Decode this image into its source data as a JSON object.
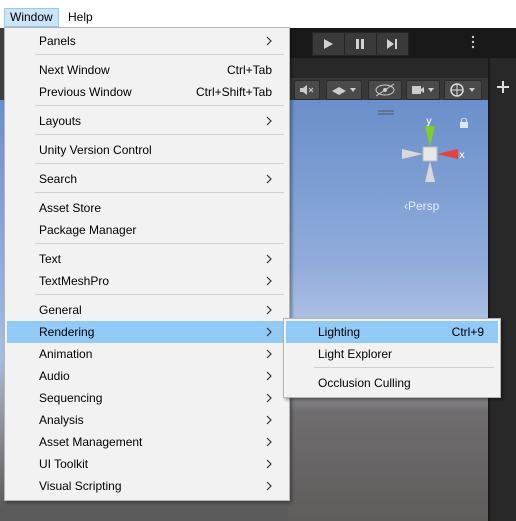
{
  "menubar": {
    "items": [
      {
        "label": "Window",
        "active": true
      },
      {
        "label": "Help",
        "active": false
      }
    ]
  },
  "toolbar": {
    "icons": [
      "play-icon",
      "pause-icon",
      "step-icon"
    ]
  },
  "scene": {
    "gizmo_axes": [
      "y",
      "x"
    ],
    "persp_label": "Persp"
  },
  "window_menu": {
    "items": [
      {
        "label": "Panels",
        "shortcut": "",
        "submenu": true
      },
      {
        "label": "Next Window",
        "shortcut": "Ctrl+Tab",
        "submenu": false
      },
      {
        "label": "Previous Window",
        "shortcut": "Ctrl+Shift+Tab",
        "submenu": false
      },
      {
        "label": "Layouts",
        "shortcut": "",
        "submenu": true
      },
      {
        "label": "Unity Version Control",
        "shortcut": "",
        "submenu": false
      },
      {
        "label": "Search",
        "shortcut": "",
        "submenu": true
      },
      {
        "label": "Asset Store",
        "shortcut": "",
        "submenu": false
      },
      {
        "label": "Package Manager",
        "shortcut": "",
        "submenu": false
      },
      {
        "label": "Text",
        "shortcut": "",
        "submenu": true
      },
      {
        "label": "TextMeshPro",
        "shortcut": "",
        "submenu": true
      },
      {
        "label": "General",
        "shortcut": "",
        "submenu": true
      },
      {
        "label": "Rendering",
        "shortcut": "",
        "submenu": true,
        "highlighted": true
      },
      {
        "label": "Animation",
        "shortcut": "",
        "submenu": true
      },
      {
        "label": "Audio",
        "shortcut": "",
        "submenu": true
      },
      {
        "label": "Sequencing",
        "shortcut": "",
        "submenu": true
      },
      {
        "label": "Analysis",
        "shortcut": "",
        "submenu": true
      },
      {
        "label": "Asset Management",
        "shortcut": "",
        "submenu": true
      },
      {
        "label": "UI Toolkit",
        "shortcut": "",
        "submenu": true
      },
      {
        "label": "Visual Scripting",
        "shortcut": "",
        "submenu": true
      }
    ]
  },
  "rendering_submenu": {
    "items": [
      {
        "label": "Lighting",
        "shortcut": "Ctrl+9",
        "highlighted": true
      },
      {
        "label": "Light Explorer",
        "shortcut": ""
      },
      {
        "label": "Occlusion Culling",
        "shortcut": ""
      }
    ]
  },
  "colors": {
    "menu_bg": "#f2f2f2",
    "highlight": "#91c9f7",
    "menubar_active": "#cce4f7",
    "gizmo_x": "#e0443a",
    "gizmo_y": "#7ecf2e"
  }
}
